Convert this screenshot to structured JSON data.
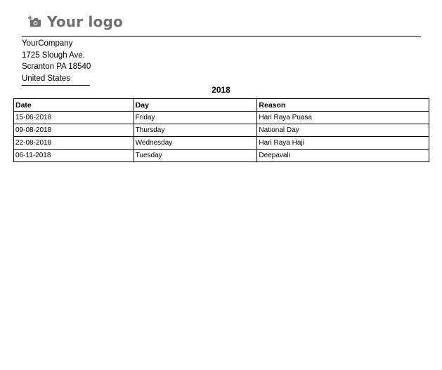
{
  "header": {
    "logo_text": "Your logo",
    "logo_icon": "camera-add-icon",
    "logo_color": "#6f6f6f"
  },
  "company": {
    "name": "YourCompany",
    "street": "1725 Slough Ave.",
    "city_line": "Scranton PA 18540",
    "country": "United States"
  },
  "report": {
    "year": "2018"
  },
  "table": {
    "headers": [
      "Date",
      "Day",
      "Reason"
    ],
    "rows": [
      [
        "15-06-2018",
        "Friday",
        "Hari Raya Puasa"
      ],
      [
        "09-08-2018",
        "Thursday",
        "National Day"
      ],
      [
        "22-08-2018",
        "Wednesday",
        "Hari Raya Haji"
      ],
      [
        "06-11-2018",
        "Tuesday",
        "Deepavali"
      ]
    ]
  }
}
